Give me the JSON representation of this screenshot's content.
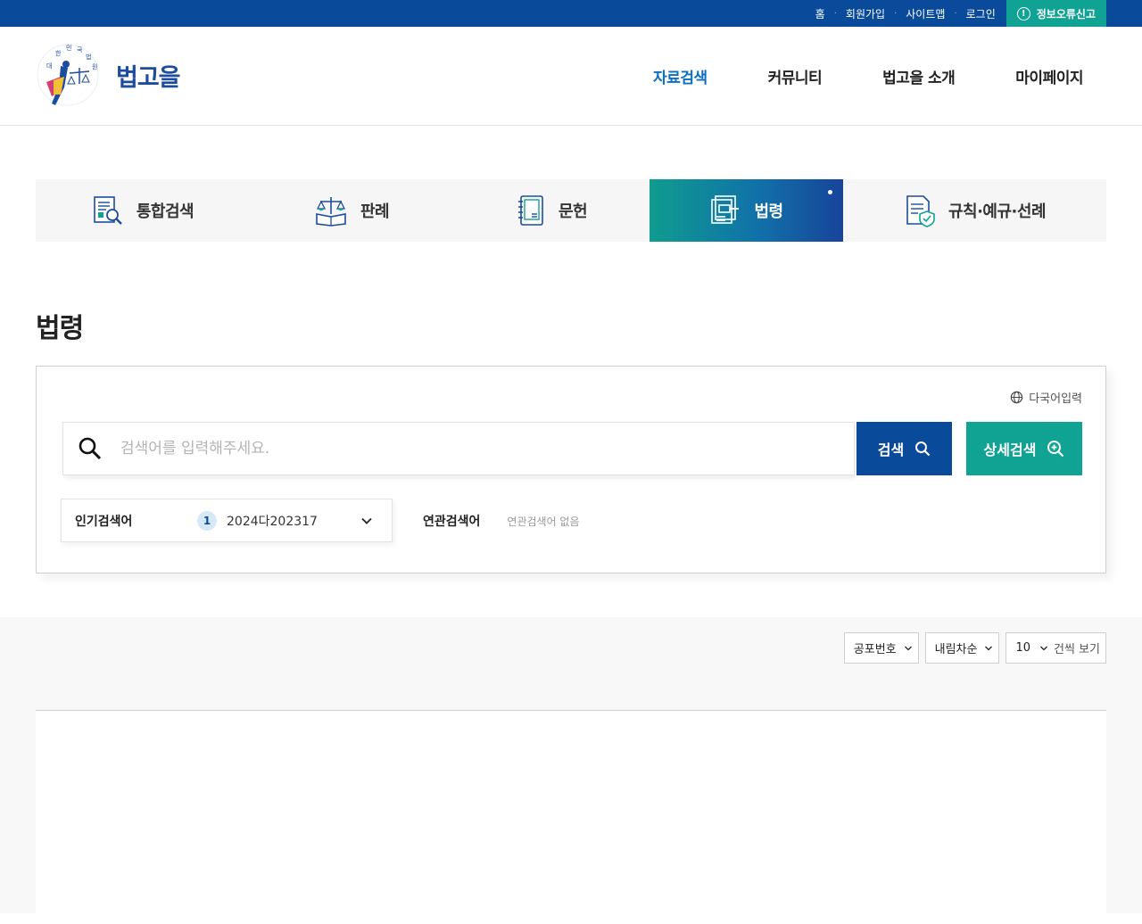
{
  "topbar": {
    "links": [
      "홈",
      "회원가입",
      "사이트맵",
      "로그인"
    ],
    "report_label": "정보오류신고"
  },
  "header": {
    "logo_text": "법고을",
    "nav": [
      {
        "label": "자료검색",
        "active": true
      },
      {
        "label": "커뮤니티",
        "active": false
      },
      {
        "label": "법고을 소개",
        "active": false
      },
      {
        "label": "마이페이지",
        "active": false
      }
    ]
  },
  "tabs": [
    {
      "label": "통합검색",
      "icon": "document-search-icon",
      "active": false
    },
    {
      "label": "판례",
      "icon": "scales-book-icon",
      "active": false
    },
    {
      "label": "문헌",
      "icon": "notebook-icon",
      "active": false
    },
    {
      "label": "법령",
      "icon": "gavel-document-icon",
      "active": true
    },
    {
      "label": "규칙·예규·선례",
      "icon": "shield-document-icon",
      "active": false
    }
  ],
  "page": {
    "title": "법령"
  },
  "search": {
    "lang_input_label": "다국어입력",
    "placeholder": "검색어를 입력해주세요.",
    "value": "",
    "search_button": "검색",
    "detail_button": "상세검색",
    "popular_label": "인기검색어",
    "popular_rank": "1",
    "popular_keyword": "2024다202317",
    "related_label": "연관검색어",
    "related_value": "연관검색어 없음"
  },
  "results": {
    "sort_by": "공포번호",
    "order": "내림차순",
    "page_size": "10",
    "page_size_suffix": "건씩 보기"
  },
  "colors": {
    "navy": "#0a4a9a",
    "teal": "#10a394",
    "active_nav": "#0b6fc2"
  }
}
